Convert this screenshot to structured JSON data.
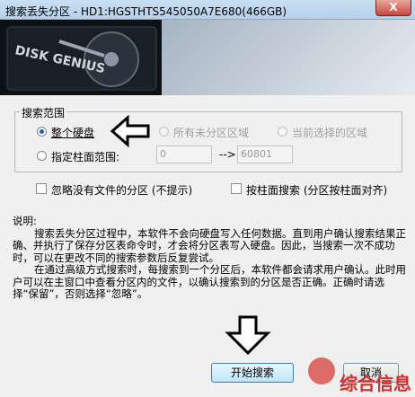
{
  "window": {
    "title": "搜索丢失分区 - HD1:HGSTHTS545050A7E680(466GB)",
    "close_label": "X"
  },
  "banner": {
    "brand_text": "DISK GENIUS"
  },
  "search_range": {
    "title": "搜索范围",
    "whole_disk": "整个硬盘",
    "unallocated": "所有未分区区域",
    "current_selected": "当前选择的区域",
    "cylinder_range": "指定柱面范围:",
    "range_from": "0",
    "range_arrow": "-->",
    "range_to": "60801"
  },
  "options": {
    "ignore_no_files": "忽略没有文件的分区 (不提示)",
    "search_by_cylinder": "按柱面搜索 (分区按柱面对齐)"
  },
  "note": {
    "heading": "说明:",
    "p1": "搜索丢失分区过程中，本软件不会向硬盘写入任何数据。直到用户确认搜索结果正确、并执行了保存分区表命令时，才会将分区表写入硬盘。因此，当搜索一次不成功时，可以在更改不同的搜索参数后反复尝试。",
    "p2": "在通过高级方式搜索时，每搜索到一个分区后，本软件都会请求用户确认。此时用户可以在主窗口中查看分区内的文件，以确认搜索到的分区是否正确。正确时请选择“保留”，否则选择“忽略”。"
  },
  "buttons": {
    "start": "开始搜索",
    "cancel": "取消"
  },
  "watermark": "综合信息",
  "colors": {
    "accent": "#1f5fa8",
    "watermark": "#d32f2f"
  }
}
